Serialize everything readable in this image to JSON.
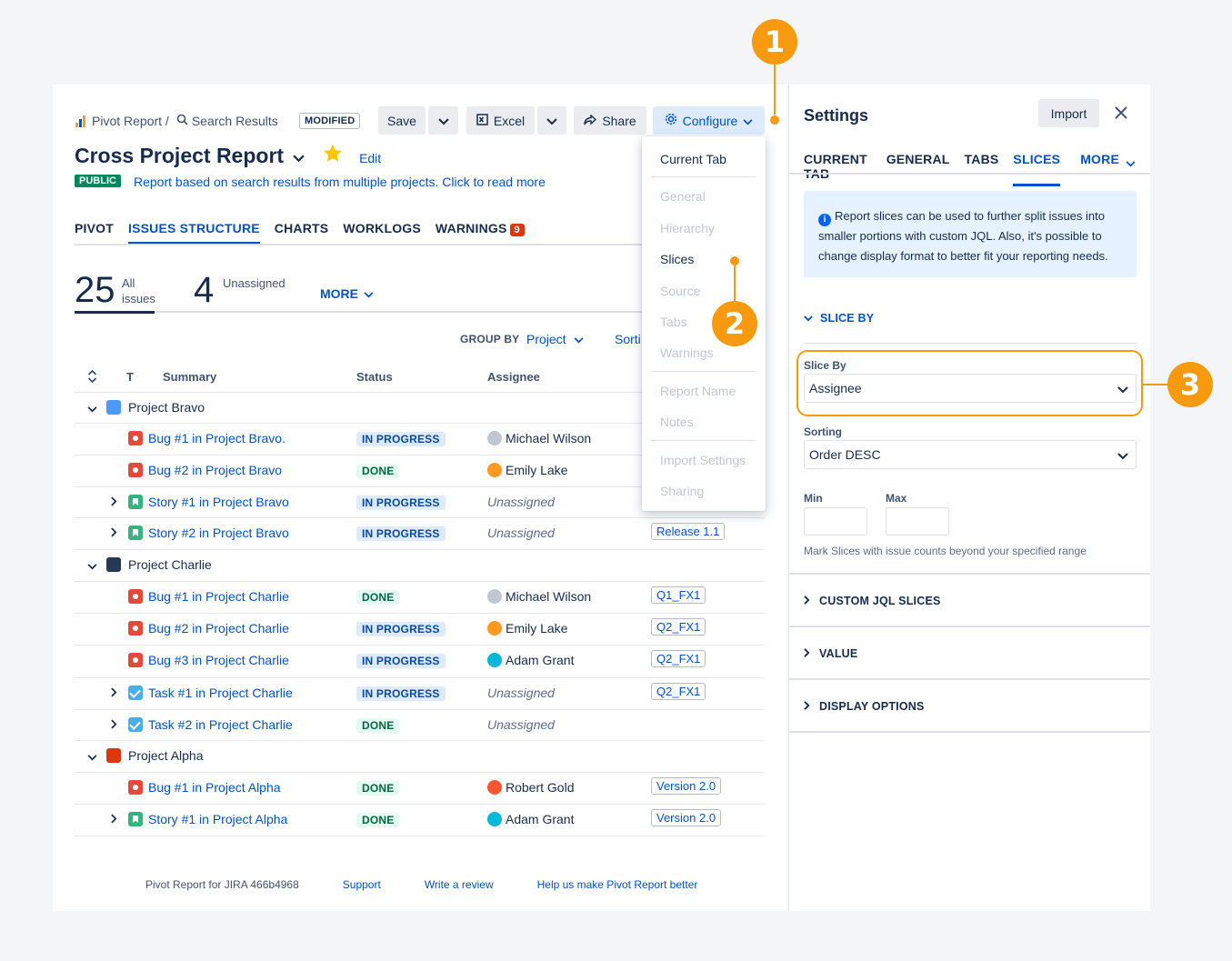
{
  "header": {
    "app_name": "Pivot Report /",
    "breadcrumb_search": "Search Results",
    "modified": "MODIFIED",
    "save": "Save",
    "excel": "Excel",
    "share": "Share",
    "configure": "Configure",
    "title": "Cross Project Report",
    "edit": "Edit",
    "public": "PUBLIC",
    "description": "Report based on search results from multiple projects. Click to read more"
  },
  "tabs": [
    "PIVOT",
    "ISSUES STRUCTURE",
    "CHARTS",
    "WORKLOGS",
    "WARNINGS"
  ],
  "warnings_count": "9",
  "stats": {
    "all_count": "25",
    "all_label_1": "All",
    "all_label_2": "issues",
    "unassigned_count": "4",
    "unassigned_label": "Unassigned",
    "more": "MORE"
  },
  "group_by": {
    "label": "GROUP BY",
    "value": "Project",
    "sort": "Sorti"
  },
  "columns": {
    "t": "T",
    "summary": "Summary",
    "status": "Status",
    "assignee": "Assignee"
  },
  "groups": [
    {
      "name": "Project Bravo",
      "color": "#4c9aff"
    },
    {
      "name": "Project Charlie",
      "color": "#253858"
    },
    {
      "name": "Project Alpha",
      "color": "#de350b"
    }
  ],
  "rows": [
    {
      "type": "bug",
      "summary": "Bug #1 in Project Bravo.",
      "status": "IN PROGRESS",
      "assignee": "Michael Wilson",
      "version": ""
    },
    {
      "type": "bug",
      "summary": "Bug #2 in Project Bravo",
      "status": "DONE",
      "assignee": "Emily Lake",
      "version": ""
    },
    {
      "type": "story",
      "summary": "Story #1 in Project Bravo",
      "status": "IN PROGRESS",
      "assignee": "Unassigned",
      "version": ""
    },
    {
      "type": "story",
      "summary": "Story #2 in Project Bravo",
      "status": "IN PROGRESS",
      "assignee": "Unassigned",
      "version": "Release 1.1"
    },
    {
      "type": "bug",
      "summary": "Bug #1 in Project Charlie",
      "status": "DONE",
      "assignee": "Michael Wilson",
      "version": "Q1_FX1"
    },
    {
      "type": "bug",
      "summary": "Bug #2 in Project Charlie",
      "status": "IN PROGRESS",
      "assignee": "Emily Lake",
      "version": "Q2_FX1"
    },
    {
      "type": "bug",
      "summary": "Bug #3 in Project Charlie",
      "status": "IN PROGRESS",
      "assignee": "Adam Grant",
      "version": "Q2_FX1"
    },
    {
      "type": "task",
      "summary": "Task #1 in Project Charlie",
      "status": "IN PROGRESS",
      "assignee": "Unassigned",
      "version": "Q2_FX1"
    },
    {
      "type": "task",
      "summary": "Task #2 in Project Charlie",
      "status": "DONE",
      "assignee": "Unassigned",
      "version": ""
    },
    {
      "type": "bug",
      "summary": "Bug #1 in Project Alpha",
      "status": "DONE",
      "assignee": "Robert Gold",
      "version": "Version 2.0"
    },
    {
      "type": "story",
      "summary": "Story #1 in Project Alpha",
      "status": "DONE",
      "assignee": "Adam Grant",
      "version": "Version 2.0"
    }
  ],
  "footer": {
    "version": "Pivot Report for JIRA 466b4968",
    "support": "Support",
    "review": "Write a review",
    "better": "Help us make Pivot Report better"
  },
  "configure_menu": [
    "Current Tab",
    "General",
    "Hierarchy",
    "Slices",
    "Source",
    "Tabs",
    "Warnings",
    "Report Name",
    "Notes",
    "Import Settings",
    "Sharing"
  ],
  "callouts": [
    "1",
    "2",
    "3"
  ],
  "settings": {
    "title": "Settings",
    "import": "Import",
    "tabs": [
      "CURRENT TAB",
      "GENERAL",
      "TABS",
      "SLICES",
      "MORE"
    ],
    "info": "Report slices can be used to further split issues into smaller portions with custom JQL. Also, it's possible to change display format to better fit your reporting needs.",
    "slice_by_section": "SLICE BY",
    "slice_by_label": "Slice By",
    "slice_by_value": "Assignee",
    "sorting_label": "Sorting",
    "sorting_value": "Order DESC",
    "min_label": "Min",
    "max_label": "Max",
    "range_hint": "Mark Slices with issue counts beyond your specified range",
    "sections": [
      "CUSTOM JQL SLICES",
      "VALUE",
      "DISPLAY OPTIONS"
    ]
  },
  "colors": {
    "accent": "#0052cc",
    "callout": "#f79a10",
    "in_progress_bg": "#deebff",
    "done_bg": "#e3fcef"
  }
}
